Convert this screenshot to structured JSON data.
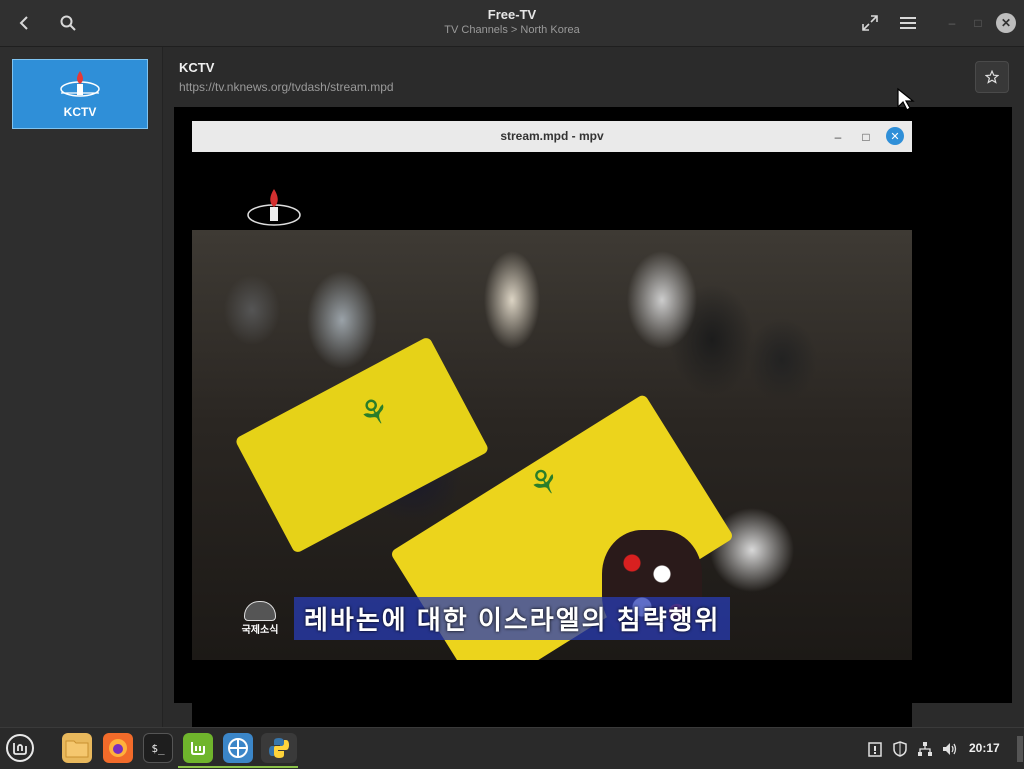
{
  "header": {
    "title": "Free-TV",
    "breadcrumb": "TV Channels > North Korea"
  },
  "sidebar": {
    "channels": [
      {
        "name": "KCTV",
        "selected": true
      }
    ]
  },
  "main": {
    "channel_name": "KCTV",
    "stream_url": "https://tv.nknews.org/tvdash/stream.mpd"
  },
  "player": {
    "window_title": "stream.mpd - mpv",
    "caption_logo_text": "국제소식",
    "caption_text": "레바논에 대한 이스라엘의 침략행위"
  },
  "taskbar": {
    "apps": [
      "menu-icon",
      "files-icon",
      "firefox-icon",
      "terminal-icon",
      "mintinstall-icon",
      "freetv-icon",
      "python-icon"
    ],
    "clock": "20:17"
  },
  "colors": {
    "accent": "#2f8fd8",
    "header_bg": "#303030",
    "taskbar_bg": "#2a2a2a"
  }
}
